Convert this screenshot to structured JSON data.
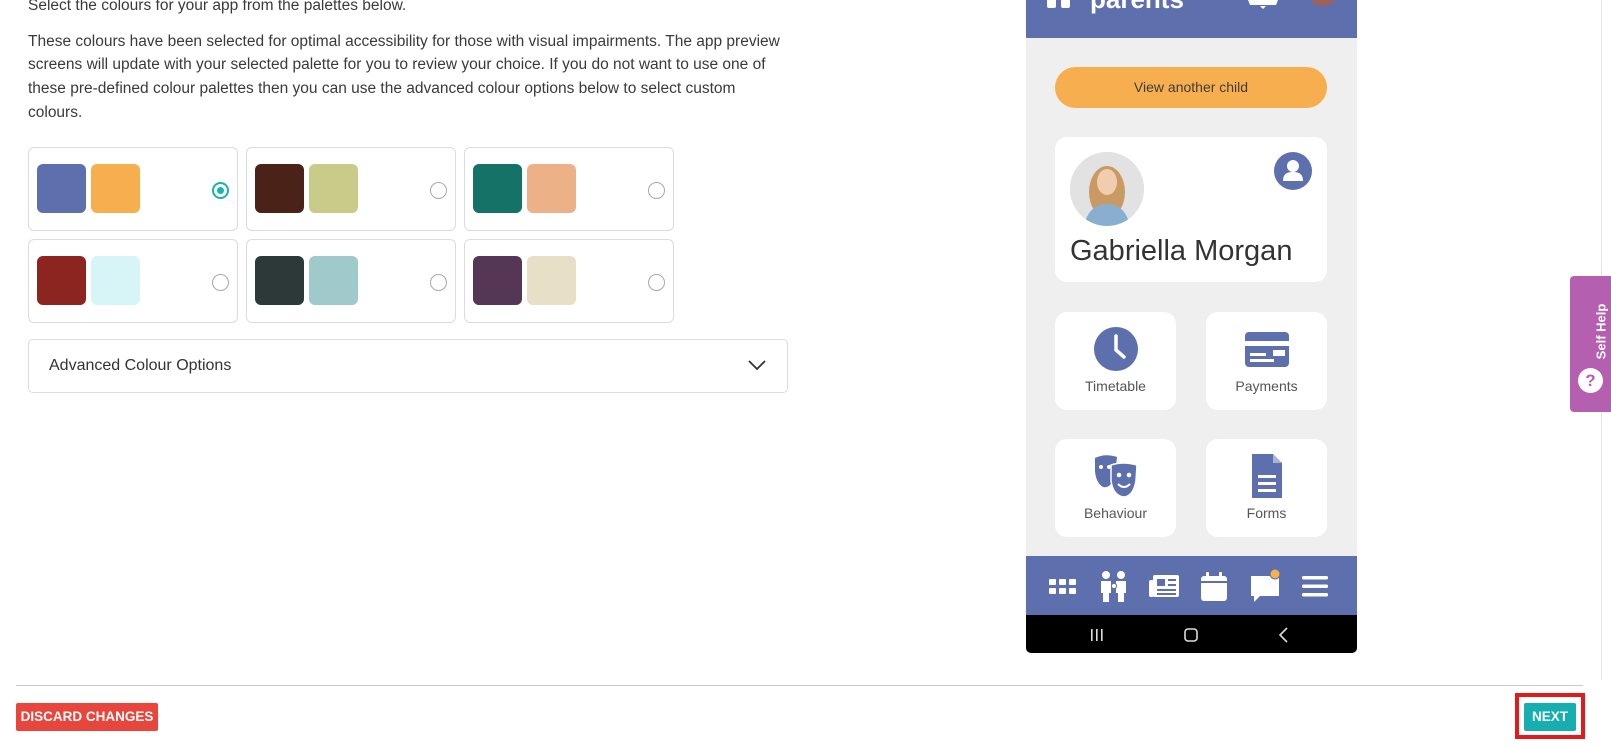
{
  "intro": {
    "line1": "Select the colours for your app from the palettes below.",
    "paragraph": "These colours have been selected for optimal accessibility for those with visual impairments. The app preview screens will update with your selected palette for you to review your choice. If you do not want to use one of these pre-defined colour palettes then you can use the advanced colour options below to select custom colours."
  },
  "palettes": [
    {
      "primary": "#5d6fad",
      "secondary": "#f7ae4e",
      "selected": true
    },
    {
      "primary": "#4a2218",
      "secondary": "#c9cb89",
      "selected": false
    },
    {
      "primary": "#157267",
      "secondary": "#edb187",
      "selected": false
    },
    {
      "primary": "#8c251f",
      "secondary": "#d7f4f7",
      "selected": false
    },
    {
      "primary": "#2c3938",
      "secondary": "#9fc9cb",
      "selected": false
    },
    {
      "primary": "#563655",
      "secondary": "#e7e0c6",
      "selected": false
    }
  ],
  "advanced": {
    "label": "Advanced Colour Options"
  },
  "preview": {
    "logo_text": "parents",
    "view_child": "View another child",
    "child_name": "Gabriella Morgan",
    "tiles": [
      {
        "label": "Timetable",
        "icon": "clock-icon"
      },
      {
        "label": "Payments",
        "icon": "credit-card-icon"
      },
      {
        "label": "Behaviour",
        "icon": "theatre-masks-icon"
      },
      {
        "label": "Forms",
        "icon": "document-icon"
      }
    ],
    "colors": {
      "primary": "#5d6fad",
      "secondary": "#f7ae4e",
      "background": "#efefef"
    }
  },
  "self_help": {
    "label": "Self Help",
    "glyph": "?"
  },
  "footer": {
    "discard": "DISCARD CHANGES",
    "next": "NEXT"
  }
}
